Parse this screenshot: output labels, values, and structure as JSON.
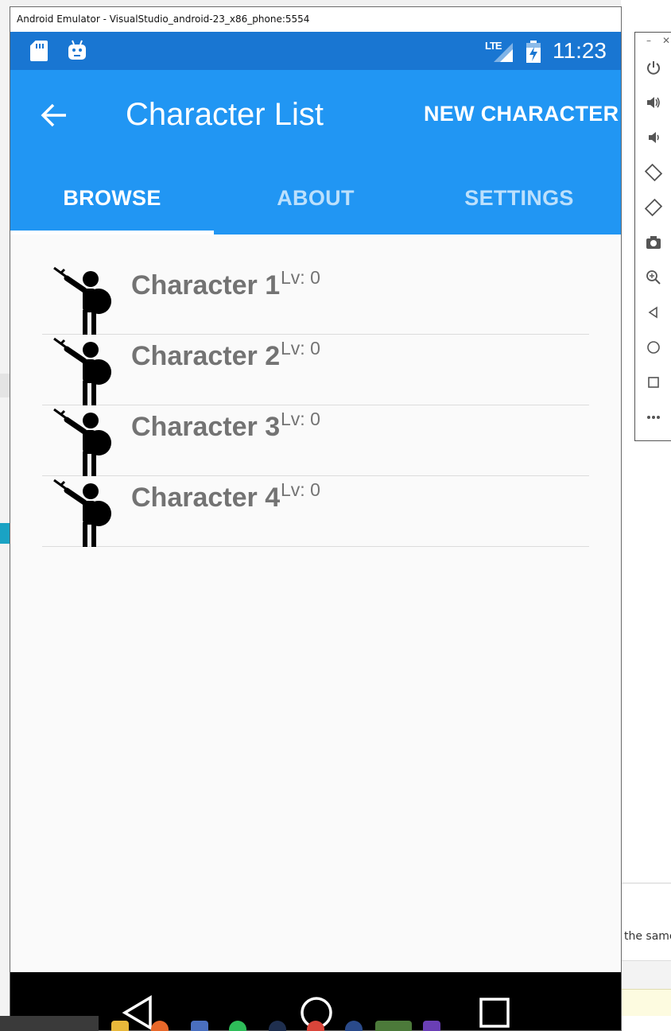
{
  "window": {
    "title": "Android Emulator - VisualStudio_android-23_x86_phone:5554"
  },
  "status_bar": {
    "network_label": "LTE",
    "time": "11:23",
    "icons": [
      "sd-card-icon",
      "android-debug-icon",
      "lte-signal-icon",
      "battery-charging-icon"
    ]
  },
  "app_bar": {
    "back_icon": "arrow-left-icon",
    "title": "Character List",
    "action_label": "NEW CHARACTER",
    "color": "#2196f3",
    "status_color": "#1976d2"
  },
  "tabs": [
    {
      "label": "BROWSE",
      "active": true
    },
    {
      "label": "ABOUT",
      "active": false
    },
    {
      "label": "SETTINGS",
      "active": false
    }
  ],
  "characters": [
    {
      "name": "Character 1",
      "level": "Lv: 0",
      "icon": "stick-figure-warrior-icon"
    },
    {
      "name": "Character 2",
      "level": "Lv: 0",
      "icon": "stick-figure-warrior-icon"
    },
    {
      "name": "Character 3",
      "level": "Lv: 0",
      "icon": "stick-figure-warrior-icon"
    },
    {
      "name": "Character 4",
      "level": "Lv: 0",
      "icon": "stick-figure-warrior-icon"
    }
  ],
  "nav_bar": {
    "icons": [
      "nav-back-icon",
      "nav-home-icon",
      "nav-recents-icon"
    ]
  },
  "emulator_toolbar": {
    "icons": [
      "power-icon",
      "volume-up-icon",
      "volume-down-icon",
      "rotate-left-icon",
      "rotate-right-icon",
      "camera-icon",
      "zoom-icon",
      "back-icon",
      "home-icon",
      "overview-icon",
      "more-icon"
    ]
  },
  "desktop": {
    "right_fragment": "the same"
  }
}
